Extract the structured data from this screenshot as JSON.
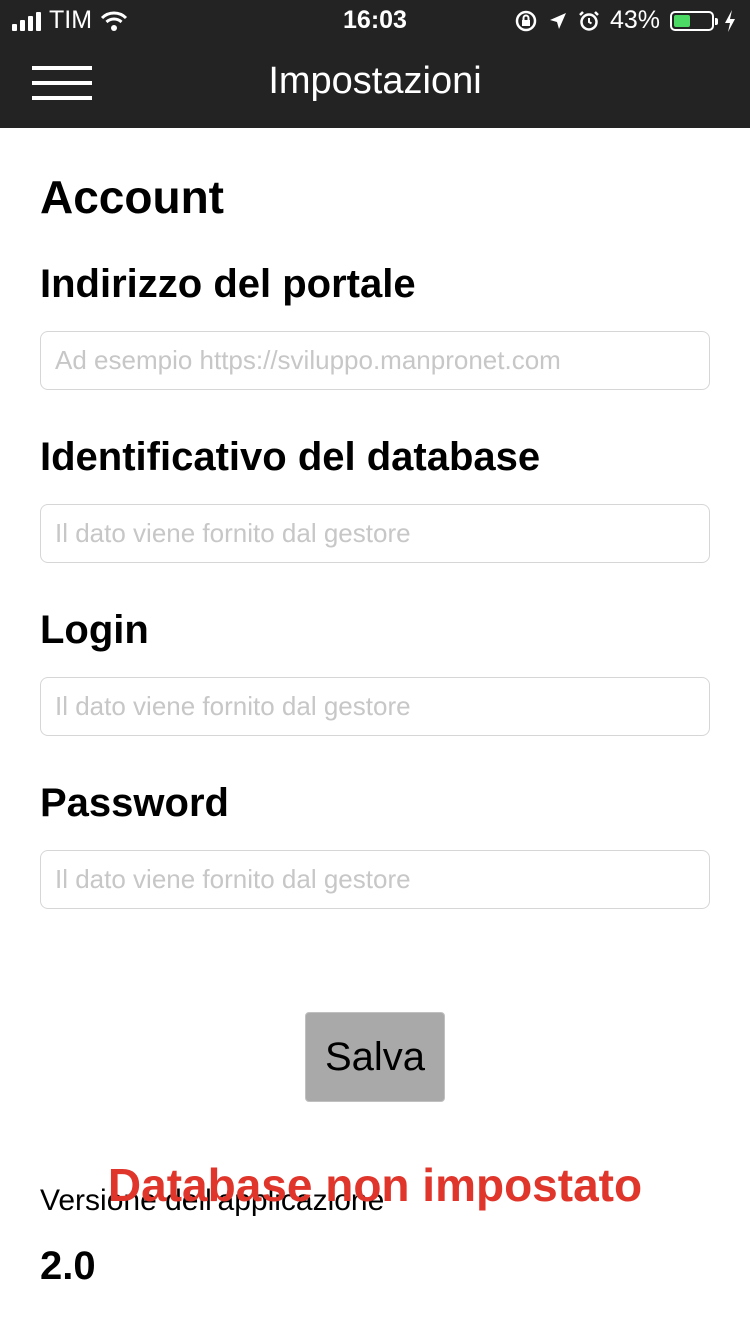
{
  "status_bar": {
    "carrier": "TIM",
    "time": "16:03",
    "battery_percent": "43%",
    "battery_level": 0.43,
    "battery_color": "#4cd964",
    "icons": [
      "signal-icon",
      "wifi-icon",
      "rotation-lock-icon",
      "location-icon",
      "alarm-icon",
      "battery-icon",
      "charging-icon"
    ]
  },
  "nav": {
    "title": "Impostazioni",
    "menu_icon": "hamburger-menu-icon",
    "background": "#232323"
  },
  "form": {
    "section_title": "Account",
    "portal": {
      "label": "Indirizzo del portale",
      "placeholder": "Ad esempio https://sviluppo.manpronet.com",
      "value": ""
    },
    "database": {
      "label": "Identificativo del database",
      "placeholder": "Il dato viene fornito dal gestore",
      "value": ""
    },
    "login": {
      "label": "Login",
      "placeholder": "Il dato viene fornito dal gestore",
      "value": ""
    },
    "password": {
      "label": "Password",
      "placeholder": "Il dato viene fornito dal gestore",
      "value": ""
    },
    "save_label": "Salva"
  },
  "footer": {
    "version_label": "Versione dell'applicazione",
    "version_value": "2.0",
    "error_message": "Database non impostato",
    "error_color": "#e0352b"
  }
}
